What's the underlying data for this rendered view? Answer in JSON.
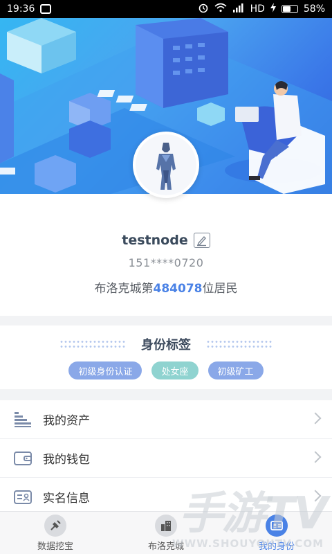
{
  "status_bar": {
    "time": "19:36",
    "network": "HD",
    "battery": "58%",
    "battery_level": 0.58
  },
  "profile": {
    "username": "testnode",
    "phone": "151****0720",
    "citizen_prefix": "布洛克城第",
    "citizen_number": "484078",
    "citizen_suffix": "位居民"
  },
  "tags": {
    "title": "身份标签",
    "items": [
      "初级身份认证",
      "处女座",
      "初级矿工"
    ]
  },
  "menu": {
    "items": [
      {
        "label": "我的资产",
        "icon": "assets-icon"
      },
      {
        "label": "我的钱包",
        "icon": "wallet-icon"
      },
      {
        "label": "实名信息",
        "icon": "id-card-icon"
      }
    ]
  },
  "bottom_nav": {
    "items": [
      {
        "label": "数据挖宝",
        "icon": "shovel-icon",
        "active": false
      },
      {
        "label": "布洛克城",
        "icon": "city-icon",
        "active": false
      },
      {
        "label": "我的身份",
        "icon": "identity-icon",
        "active": true
      }
    ]
  },
  "watermark": {
    "text": "手游TV",
    "url": "WWW.SHOUYOUTV.COM"
  },
  "colors": {
    "accent": "#4a82e6",
    "tag_blue": "#8aa8e8",
    "tag_teal": "#8fd3d0"
  }
}
